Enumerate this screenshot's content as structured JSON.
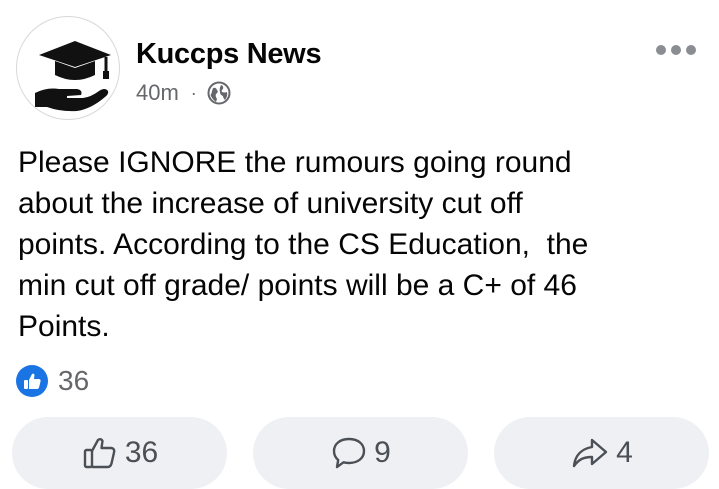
{
  "post": {
    "author": "Kuccps News",
    "time": "40m",
    "separator": "·",
    "audience_icon": "globe-icon",
    "avatar_icon": "graduation-cap-hand-icon",
    "menu_icon": "more-options-icon",
    "text": "Please IGNORE the rumours going round\nabout the increase of university cut off\npoints. According to the CS Education,  the\nmin cut off grade/ points will be a C+ of 46\nPoints."
  },
  "reactions": {
    "icon": "like-reaction-icon",
    "count": "36"
  },
  "actions": {
    "like": {
      "icon": "thumbs-up-icon",
      "count": "36"
    },
    "comment": {
      "icon": "comment-icon",
      "count": "9"
    },
    "share": {
      "icon": "share-arrow-icon",
      "count": "4"
    }
  },
  "colors": {
    "like_blue": "#1b74e4",
    "secondary_text": "#65676b",
    "button_bg": "#eef0f3"
  }
}
